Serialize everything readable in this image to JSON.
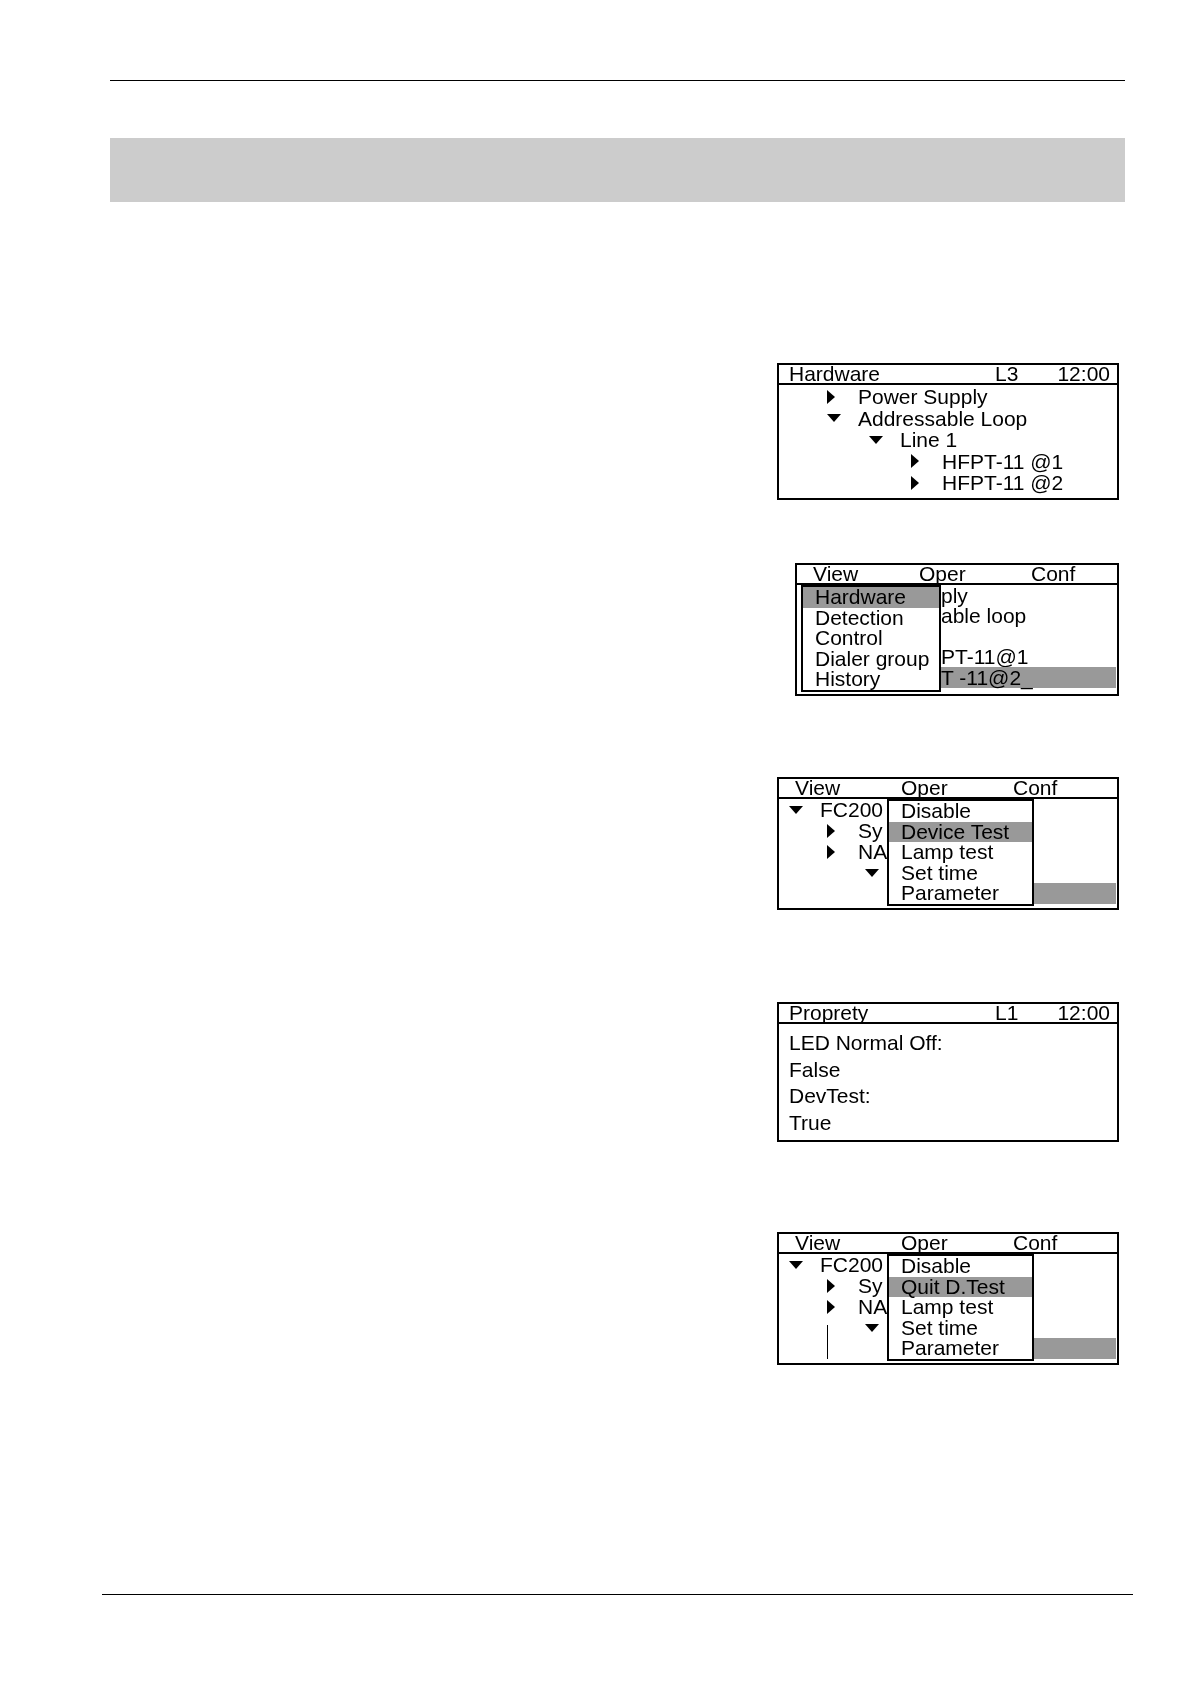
{
  "screens": [
    {
      "kind": "tree",
      "header": {
        "title": "Hardware",
        "indicator": "L3",
        "time": "12:00"
      },
      "tree": [
        {
          "label": "Power Supply",
          "expanded": false
        },
        {
          "label": "Addressable Loop",
          "expanded": true,
          "children": [
            {
              "label": "Line 1",
              "expanded": true,
              "children": [
                {
                  "label": "HFPT-11 @1",
                  "expanded": false
                },
                {
                  "label": "HFPT-11 @2",
                  "expanded": false
                }
              ]
            }
          ]
        }
      ]
    },
    {
      "kind": "menu",
      "menu_bar": [
        "View",
        "Oper",
        "Conf"
      ],
      "dropdown": [
        {
          "label": "Hardware",
          "selected": true
        },
        {
          "label": "Detection",
          "selected": false
        },
        {
          "label": "Control",
          "selected": false
        },
        {
          "label": "Dialer group",
          "selected": false
        },
        {
          "label": "History",
          "selected": false
        }
      ],
      "rows": [
        {
          "label": "ply",
          "selected": false
        },
        {
          "label": "able loop",
          "selected": false
        },
        {
          "selected": false
        },
        {
          "label": "PT-11@1",
          "selected": false
        },
        {
          "label": "T -11@2_",
          "selected": true
        }
      ]
    },
    {
      "kind": "menu",
      "menu_bar": [
        "View",
        "Oper",
        "Conf"
      ],
      "tree": [
        {
          "label": "FC200",
          "expanded": true,
          "selected": false,
          "children": [
            {
              "label": "Sy",
              "expanded": false,
              "selected": false
            },
            {
              "label": "NA",
              "expanded": false,
              "selected": false,
              "children": [
                {
                  "expanded": true,
                  "selected": false,
                  "children": [
                    {
                      "selected": true
                    }
                  ]
                }
              ]
            }
          ]
        }
      ],
      "dropdown": [
        {
          "label": "Disable",
          "selected": false
        },
        {
          "label": "Device Test",
          "selected": true
        },
        {
          "label": "Lamp test",
          "selected": false
        },
        {
          "label": "Set time",
          "selected": false
        },
        {
          "label": "Parameter",
          "selected": false
        }
      ]
    },
    {
      "kind": "property",
      "header": {
        "title": "Proprety",
        "indicator": "L1",
        "time": "12:00"
      },
      "properties": [
        {
          "name": "LED Normal Off:",
          "value": "False"
        },
        {
          "name": "DevTest:",
          "value": "True"
        }
      ]
    },
    {
      "kind": "menu",
      "menu_bar": [
        "View",
        "Oper",
        "Conf"
      ],
      "tree": [
        {
          "label": "FC200",
          "expanded": true,
          "selected": false,
          "children": [
            {
              "label": "Sy",
              "expanded": false,
              "selected": false
            },
            {
              "label": "NA",
              "expanded": false,
              "selected": false,
              "guide_line": true,
              "children": [
                {
                  "expanded": true,
                  "selected": false,
                  "children": [
                    {
                      "selected": true
                    }
                  ]
                }
              ]
            }
          ]
        }
      ],
      "dropdown": [
        {
          "label": "Disable",
          "selected": false
        },
        {
          "label": "Quit D.Test",
          "selected": true
        },
        {
          "label": "Lamp test",
          "selected": false
        },
        {
          "label": "Set time",
          "selected": false
        },
        {
          "label": "Parameter",
          "selected": false
        }
      ]
    }
  ]
}
